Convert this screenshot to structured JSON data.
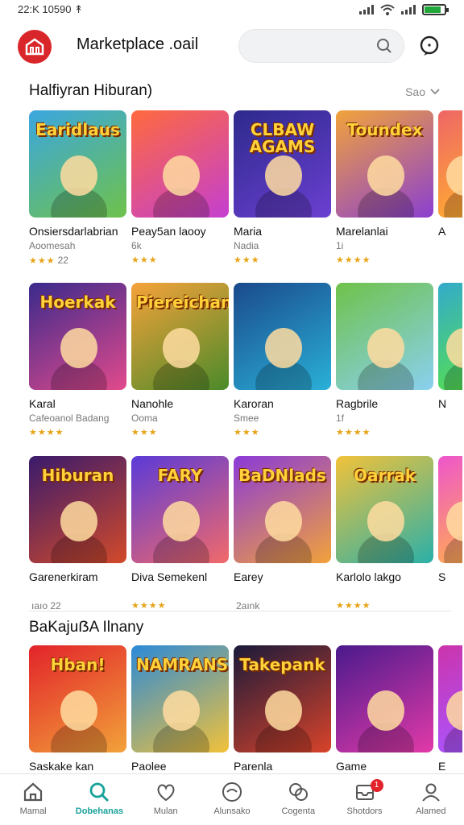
{
  "status_bar": {
    "time": "22:K 10590",
    "arrow": "↟"
  },
  "header": {
    "app_title": "Marketplace .oail",
    "search_placeholder": ""
  },
  "sections": [
    {
      "title": "Halfiyran Hiburan)",
      "see_all": "Sao",
      "rows": [
        [
          {
            "name": "Onsiersdarlabrian",
            "sub": "Aoomesah",
            "stars": 3,
            "rating_text": "22",
            "art": "Earidlaus",
            "colors": [
              "#3ba6e0",
              "#6fc24a"
            ]
          },
          {
            "name": "Peay5an laooy",
            "sub": "6k",
            "stars": 3,
            "rating_text": "",
            "art": "",
            "colors": [
              "#ff6a3d",
              "#c43fd1"
            ]
          },
          {
            "name": "Maria",
            "sub": "Nadia",
            "stars": 3,
            "rating_text": "",
            "art": "CLBAW AGAMS",
            "colors": [
              "#2d2a8c",
              "#6b3fd1"
            ]
          },
          {
            "name": "Marelanlai",
            "sub": "1i",
            "stars": 4,
            "rating_text": "",
            "art": "Toundex",
            "colors": [
              "#f2a33a",
              "#8a3fd1"
            ]
          },
          {
            "name": "A",
            "sub": "",
            "stars": 0,
            "rating_text": "",
            "art": "",
            "colors": [
              "#e66",
              "#fa3"
            ]
          }
        ],
        [
          {
            "name": "Karal",
            "sub": "Cafeoanol Badang",
            "stars": 4,
            "rating_text": "",
            "art": "Hoerkak",
            "colors": [
              "#3a2a8c",
              "#e24a8c"
            ]
          },
          {
            "name": "Nanohle",
            "sub": "Ooma",
            "stars": 3,
            "rating_text": "",
            "art": "Piereichan",
            "colors": [
              "#f6a23a",
              "#4a8a2a"
            ]
          },
          {
            "name": "Karoran",
            "sub": "Smee",
            "stars": 3,
            "rating_text": "",
            "art": "",
            "colors": [
              "#1a4a8c",
              "#2ab0d8"
            ]
          },
          {
            "name": "Ragbrile",
            "sub": "1f",
            "stars": 4,
            "rating_text": "",
            "art": "",
            "colors": [
              "#6fc24a",
              "#8ad0f0"
            ]
          },
          {
            "name": "N",
            "sub": "",
            "stars": 0,
            "rating_text": "",
            "art": "",
            "colors": [
              "#3ac",
              "#5d5"
            ]
          }
        ],
        [
          {
            "name": "Garenerkiram",
            "sub": "",
            "stars": 0,
            "rating_text": "ıaıo 22",
            "art": "Hiburan",
            "colors": [
              "#3a1a6c",
              "#d24a2a"
            ]
          },
          {
            "name": "Diva Semekenl",
            "sub": "",
            "stars": 4,
            "rating_text": "",
            "art": "FARY",
            "colors": [
              "#5a3ad8",
              "#f26a6a"
            ]
          },
          {
            "name": "Earey",
            "sub": "",
            "stars": 0,
            "rating_text": "2aınk",
            "art": "BaDNlads",
            "colors": [
              "#8a3ad8",
              "#f2a23a"
            ]
          },
          {
            "name": "Karlolo lakgo",
            "sub": "",
            "stars": 4,
            "rating_text": "",
            "art": "Oarrak",
            "colors": [
              "#f2c23a",
              "#2ab0a8"
            ]
          },
          {
            "name": "S",
            "sub": "",
            "stars": 0,
            "rating_text": "",
            "art": "",
            "colors": [
              "#e5c",
              "#fa5"
            ]
          }
        ]
      ]
    },
    {
      "title": "BaKajuẞA Ilnany",
      "rows": [
        [
          {
            "name": "Saskake kan",
            "art": "Hban!",
            "colors": [
              "#e2232a",
              "#f2a23a"
            ]
          },
          {
            "name": "Paolee",
            "art": "NAMRANS",
            "colors": [
              "#2a8ad8",
              "#f2c23a"
            ]
          },
          {
            "name": "Parenla",
            "art": "Takepank",
            "colors": [
              "#1a1a3a",
              "#d8432a"
            ]
          },
          {
            "name": "Game",
            "art": "",
            "colors": [
              "#4a1a8c",
              "#e23aa8"
            ]
          },
          {
            "name": "E",
            "art": "",
            "colors": [
              "#c3a",
              "#a5f"
            ]
          }
        ]
      ]
    }
  ],
  "bottom_nav": [
    {
      "label": "Mamal",
      "icon": "home-icon",
      "active": false,
      "badge": ""
    },
    {
      "label": "Dobehanas",
      "icon": "search-icon",
      "active": true,
      "badge": ""
    },
    {
      "label": "Mulan",
      "icon": "heart-icon",
      "active": false,
      "badge": ""
    },
    {
      "label": "Alunsako",
      "icon": "compass-icon",
      "active": false,
      "badge": ""
    },
    {
      "label": "Cogenta",
      "icon": "chat-icon",
      "active": false,
      "badge": ""
    },
    {
      "label": "Shotdors",
      "icon": "inbox-icon",
      "active": false,
      "badge": "1"
    },
    {
      "label": "Alamed",
      "icon": "profile-icon",
      "active": false,
      "badge": ""
    }
  ],
  "accent_color": "#19a29a",
  "brand_color": "#d9262a"
}
